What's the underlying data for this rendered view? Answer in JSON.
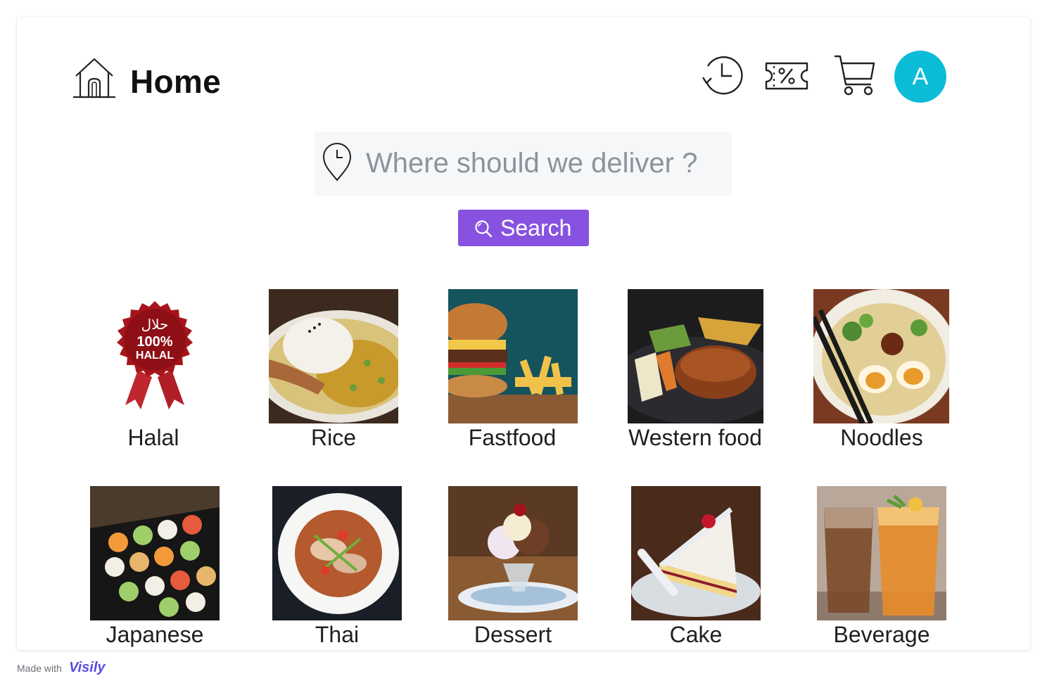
{
  "header": {
    "title": "Home",
    "home_icon": "home-icon",
    "actions": [
      {
        "name": "history",
        "icon": "history-icon"
      },
      {
        "name": "vouchers",
        "icon": "coupon-percent-icon"
      },
      {
        "name": "cart",
        "icon": "cart-icon"
      }
    ],
    "avatar_initial": "A",
    "avatar_color": "#0bbcd6"
  },
  "search": {
    "placeholder": "Where should we deliver ?",
    "value": "",
    "location_icon": "location-pin-icon",
    "button_label": "Search",
    "button_icon": "search-icon",
    "button_color": "#8752e0"
  },
  "categories": [
    {
      "label": "Halal",
      "badge_text_arabic": "حلال",
      "badge_text_percent": "100%",
      "badge_text_word": "HALAL"
    },
    {
      "label": "Rice"
    },
    {
      "label": "Fastfood"
    },
    {
      "label": "Western food"
    },
    {
      "label": "Noodles"
    },
    {
      "label": "Japanese"
    },
    {
      "label": "Thai"
    },
    {
      "label": "Dessert"
    },
    {
      "label": "Cake"
    },
    {
      "label": "Beverage"
    }
  ],
  "footer": {
    "made_with": "Made with",
    "brand": "Visily"
  }
}
